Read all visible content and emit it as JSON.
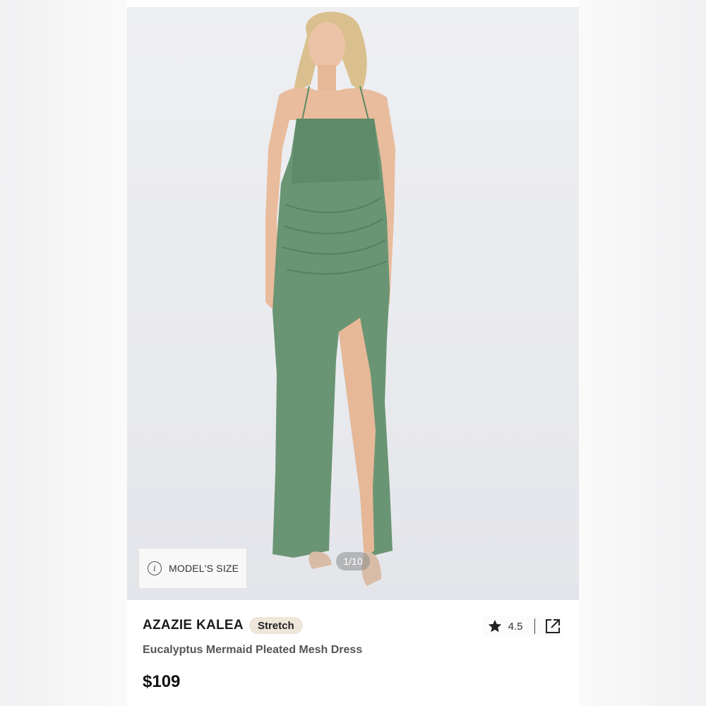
{
  "gallery": {
    "model_size_label": "MODEL'S SIZE",
    "page_indicator": "1/10",
    "dress_color": "#6a9574"
  },
  "product": {
    "brand": "AZAZIE KALEA",
    "badge": "Stretch",
    "name": "Eucalyptus Mermaid Pleated Mesh Dress",
    "price": "$109",
    "rating": "4.5"
  },
  "icons": {
    "info": "info-icon",
    "star": "star-icon",
    "share": "external-link-icon"
  },
  "colors": {
    "badge_bg": "#efe6da",
    "price_text": "#111111"
  }
}
